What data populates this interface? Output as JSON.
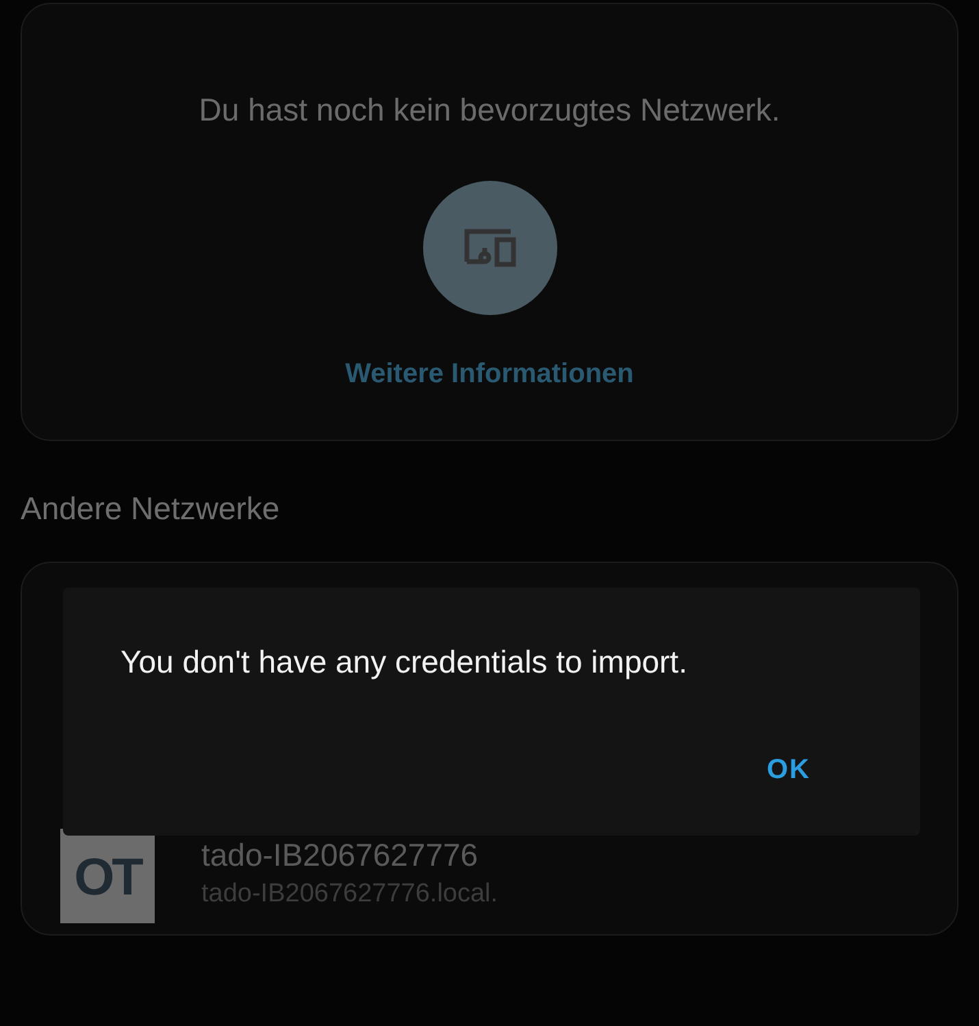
{
  "preferred_card": {
    "message": "Du hast noch kein bevorzugtes Netzwerk.",
    "link": "Weitere Informationen"
  },
  "other_networks": {
    "heading": "Andere Netzwerke",
    "items": [
      {
        "logo": "OT",
        "name": "tado-IB2067627776",
        "host": "tado-IB2067627776.local."
      }
    ]
  },
  "dialog": {
    "message": "You don't have any credentials to import.",
    "button": "OK"
  }
}
